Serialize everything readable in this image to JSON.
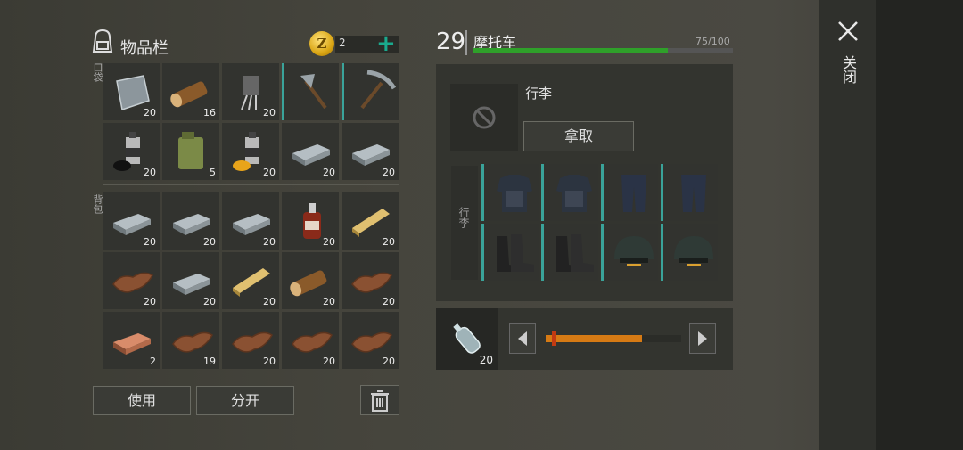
{
  "inventory": {
    "title": "物品栏",
    "coins": "2",
    "coin_symbol": "Z",
    "pocket_label": "口袋",
    "backpack_label": "背包",
    "pockets": [
      {
        "icon": "scrap-metal-icon",
        "qty": "20"
      },
      {
        "icon": "log-icon",
        "qty": "16"
      },
      {
        "icon": "transistor-icon",
        "qty": "20"
      },
      {
        "icon": "hatchet-icon",
        "qty": "",
        "equipped": true
      },
      {
        "icon": "pickaxe-icon",
        "qty": "",
        "equipped": true
      },
      {
        "icon": "spray-can-black-icon",
        "qty": "20"
      },
      {
        "icon": "jerrycan-icon",
        "qty": "5"
      },
      {
        "icon": "spray-can-yellow-icon",
        "qty": "20"
      },
      {
        "icon": "iron-ingot-icon",
        "qty": "20"
      },
      {
        "icon": "iron-ingot-icon",
        "qty": "20"
      }
    ],
    "backpack": [
      {
        "icon": "iron-ingot-icon",
        "qty": "20"
      },
      {
        "icon": "iron-ingot-icon",
        "qty": "20"
      },
      {
        "icon": "iron-ingot-icon",
        "qty": "20"
      },
      {
        "icon": "bottle-icon",
        "qty": "20"
      },
      {
        "icon": "plank-icon",
        "qty": "20"
      },
      {
        "icon": "leather-icon",
        "qty": "20"
      },
      {
        "icon": "iron-ingot-icon",
        "qty": "20"
      },
      {
        "icon": "plank-icon",
        "qty": "20"
      },
      {
        "icon": "log-icon",
        "qty": "20"
      },
      {
        "icon": "leather-icon",
        "qty": "20"
      },
      {
        "icon": "copper-ingot-icon",
        "qty": "2"
      },
      {
        "icon": "leather-icon",
        "qty": "19"
      },
      {
        "icon": "leather-icon",
        "qty": "20"
      },
      {
        "icon": "leather-icon",
        "qty": "20"
      },
      {
        "icon": "leather-icon",
        "qty": "20"
      }
    ],
    "use_label": "使用",
    "split_label": "分开"
  },
  "vehicle": {
    "level": "29",
    "name": "摩托车",
    "durability": "75/100",
    "durability_fraction": 0.75,
    "trunk_label": "行李",
    "take_label": "拿取",
    "equip_label": "行李",
    "equipment": [
      {
        "icon": "armor-vest-icon"
      },
      {
        "icon": "armor-vest-icon"
      },
      {
        "icon": "armor-pants-icon"
      },
      {
        "icon": "armor-pants-icon"
      },
      {
        "icon": "boots-icon"
      },
      {
        "icon": "boots-icon"
      },
      {
        "icon": "helmet-icon"
      },
      {
        "icon": "helmet-icon"
      }
    ],
    "fuel_item": {
      "icon": "fuel-bottle-icon",
      "qty": "20"
    },
    "fuel_fraction": 0.71
  },
  "close_label": "关闭",
  "colors": {
    "accent": "#1aa98d",
    "hp": "#2fa02a",
    "fuel": "#d67a14",
    "equip_marker": "#3aa39a"
  }
}
